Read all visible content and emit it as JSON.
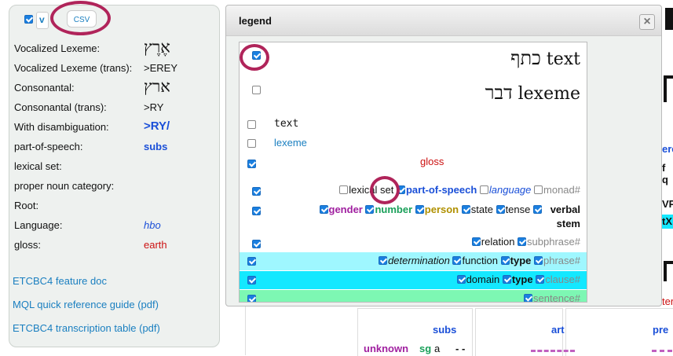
{
  "toolbar": {
    "csv_label": "CSV",
    "v_label": "v"
  },
  "features": [
    {
      "label": "Vocalized Lexeme:",
      "value": "אֶרֶץ",
      "kind": "heb"
    },
    {
      "label": "Vocalized Lexeme (trans):",
      "value": ">EREY",
      "kind": "plain"
    },
    {
      "label": "Consonantal:",
      "value": "ארץ",
      "kind": "heb"
    },
    {
      "label": "Consonantal (trans):",
      "value": ">RY",
      "kind": "plain"
    },
    {
      "label": "With disambiguation:",
      "value": ">RY/",
      "kind": "bold-blue"
    },
    {
      "label": "part-of-speech:",
      "value": "subs",
      "kind": "bold-blue-s"
    },
    {
      "label": "lexical set:",
      "value": "",
      "kind": "plain"
    },
    {
      "label": "proper noun category:",
      "value": "",
      "kind": "plain"
    },
    {
      "label": "Root:",
      "value": "",
      "kind": "plain"
    },
    {
      "label": "Language:",
      "value": "hbo",
      "kind": "italic-blue"
    },
    {
      "label": "gloss:",
      "value": "earth",
      "kind": "red"
    }
  ],
  "links": {
    "feature_doc": "ETCBC4 feature doc",
    "mql_ref": "MQL quick reference guide (pdf)",
    "transcription": "ETCBC4 transcription table (pdf)"
  },
  "legend": {
    "title": "legend",
    "close": "×",
    "text_heb": "כתף",
    "text_label": "text",
    "lexeme_heb": "דבר",
    "lexeme_label": "lexeme",
    "text_mono": "text",
    "lexeme_blue": "lexeme",
    "gloss": "gloss",
    "lexical_set": "lexical set",
    "part_of_speech": "part-of-speech",
    "language": "language",
    "monad": "monad#",
    "gender": "gender",
    "number": "number",
    "person": "person",
    "state": "state",
    "tense": "tense",
    "verbal_stem": "verbal stem",
    "relation": "relation",
    "subphrase": "subphrase#",
    "determination": "determination",
    "function": "function",
    "type1": "type",
    "phrase": "phrase#",
    "domain": "domain",
    "type2": "type",
    "clause": "clause#",
    "sentence": "sentence#"
  },
  "background": {
    "subs": "subs",
    "art": "art",
    "pre": "pre",
    "unknown": "unknown",
    "sg": "sg",
    "a": "a",
    "dashes": "- -",
    "ere": "ere",
    "fq": "f q",
    "vp": "VP",
    "tx": "tX",
    "ter": "ter"
  },
  "colors": {
    "ring": "#b0245a",
    "blue_link": "#1a7fc0",
    "gloss_red": "#cc1111",
    "phrase_bg": "#9ff7ff",
    "clause_bg": "#14e8ff",
    "sentence_bg": "#7df7b3"
  }
}
